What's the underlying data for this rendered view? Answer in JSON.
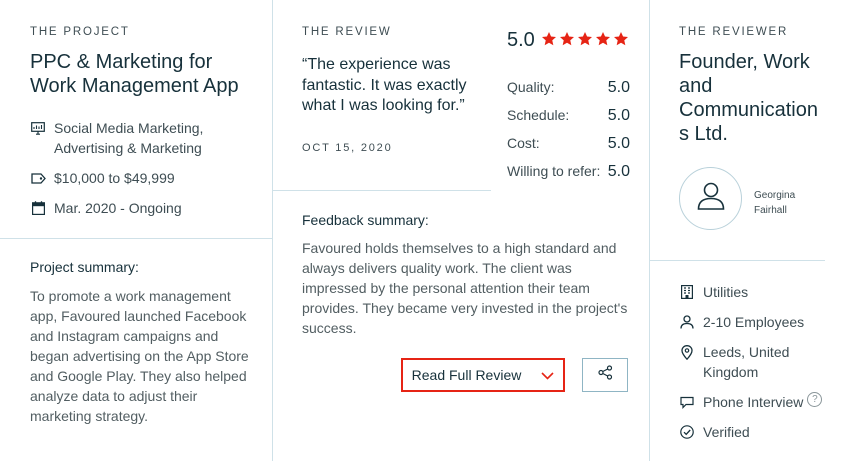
{
  "project": {
    "eyebrow": "THE PROJECT",
    "title": "PPC & Marketing for Work Management App",
    "services_line1": "Social Media Marketing,",
    "services_line2": "Advertising & Marketing",
    "budget": "$10,000 to $49,999",
    "timeline": "Mar. 2020 - Ongoing",
    "summary_label": "Project summary:",
    "summary": "To promote a work management app, Favoured launched Facebook and Instagram campaigns and began advertising on the App Store and Google Play. They also helped analyze data to adjust their marketing strategy."
  },
  "review": {
    "eyebrow": "THE REVIEW",
    "quote": "“The experience was fantastic. It was exactly what I was looking for.”",
    "date": "OCT 15, 2020",
    "overall": "5.0",
    "stars": 5,
    "star_color": "#e62415",
    "ratings": [
      {
        "label": "Quality:",
        "value": "5.0"
      },
      {
        "label": "Schedule:",
        "value": "5.0"
      },
      {
        "label": "Cost:",
        "value": "5.0"
      },
      {
        "label": "Willing to refer:",
        "value": "5.0"
      }
    ],
    "feedback_label": "Feedback summary:",
    "feedback": "Favoured holds themselves to a high standard and always delivers quality work. The client was impressed by the personal attention their team provides. They became very invested in the project's success.",
    "read_full_label": "Read Full Review"
  },
  "reviewer": {
    "eyebrow": "THE REVIEWER",
    "title": "Founder, Work and Communication s Ltd.",
    "name": "Georgina Fairhall",
    "industry": "Utilities",
    "employees": "2-10 Employees",
    "location": "Leeds, United Kingdom",
    "interview": "Phone Interview",
    "interview_help": "?",
    "verified": "Verified"
  },
  "colors": {
    "accent": "#e62415",
    "text_dark": "#17313b",
    "divider": "#cfe1e8"
  }
}
